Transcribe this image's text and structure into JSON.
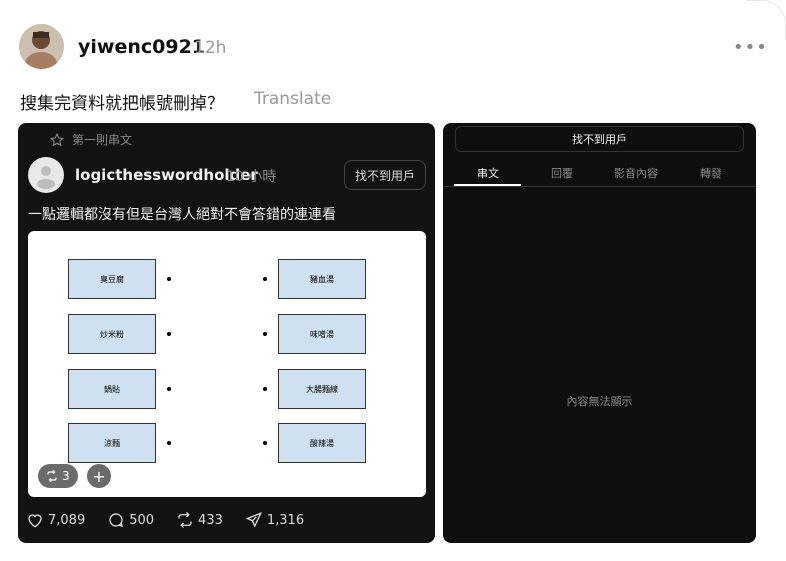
{
  "post": {
    "username": "yiwenc0921",
    "time": "12h",
    "text": "搜集完資料就把帳號刪掉？",
    "translate_label": "Translate",
    "more_label": "•••"
  },
  "quoted": {
    "pin_label": "第一則串文",
    "username": "logicthesswordholder",
    "time": "10 小時",
    "notfound_label": "找不到用戶",
    "text": "一點邏輯都沒有但是台灣人絕對不會答錯的連連看",
    "left_items": [
      "臭豆腐",
      "炒米粉",
      "鍋貼",
      "涼麵"
    ],
    "right_items": [
      "豬血湯",
      "味噌湯",
      "大腸麵線",
      "酸辣湯"
    ],
    "repost_count": "3",
    "plus_label": "+"
  },
  "stats": {
    "likes": "7,089",
    "comments": "500",
    "reposts": "433",
    "shares": "1,316"
  },
  "right_card": {
    "header": "找不到用戶",
    "tabs": [
      "串文",
      "回覆",
      "影音內容",
      "轉發"
    ],
    "empty_text": "內容無法顯示"
  }
}
